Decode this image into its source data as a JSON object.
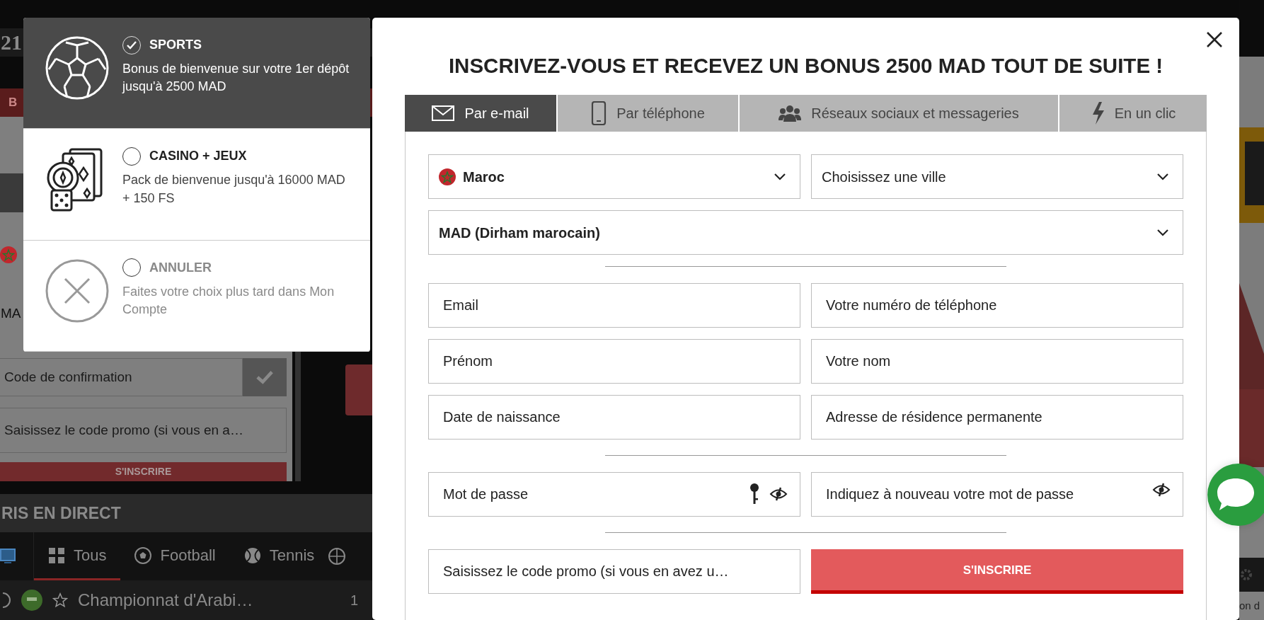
{
  "background": {
    "logo": "21",
    "tab": "B",
    "currency": "MA",
    "confirmation_field": {
      "placeholder": "Code de confirmation"
    },
    "promo_field": {
      "placeholder": "Saisissez le code promo (si vous en a…"
    },
    "submit": "S'INSCRIRE",
    "live_title": "RIS EN DIRECT",
    "sport_tabs": [
      {
        "label": "Tous",
        "selected": true
      },
      {
        "label": "Football",
        "selected": false
      },
      {
        "label": "Tennis",
        "selected": false
      }
    ],
    "event_row": {
      "name": "Championnat d'Arabi…",
      "count": "1"
    },
    "footer_text": "on d"
  },
  "bonus_options": [
    {
      "kind": "sports",
      "title": "SPORTS",
      "description": "Bonus de bienvenue sur votre 1er dépôt jusqu'à 2500 MAD",
      "selected": true
    },
    {
      "kind": "casino",
      "title": "CASINO + JEUX",
      "description": "Pack de bienvenue jusqu'à 16000 MAD + 150 FS",
      "selected": false
    },
    {
      "kind": "cancel",
      "title": "ANNULER",
      "description": "Faites votre choix plus tard dans Mon Compte",
      "selected": false
    }
  ],
  "modal": {
    "title": "INSCRIVEZ-VOUS ET RECEVEZ UN BONUS 2500 MAD TOUT DE SUITE !",
    "tabs": [
      {
        "kind": "email",
        "label": "Par e-mail",
        "selected": true
      },
      {
        "kind": "phone",
        "label": "Par téléphone",
        "selected": false
      },
      {
        "kind": "social",
        "label": "Réseaux sociaux et messageries",
        "selected": false
      },
      {
        "kind": "oneclick",
        "label": "En un clic",
        "selected": false
      }
    ],
    "country": {
      "value": "Maroc"
    },
    "city": {
      "placeholder": "Choisissez une ville"
    },
    "currency": {
      "value": "MAD (Dirham marocain)"
    },
    "fields": [
      {
        "placeholder": "Email"
      },
      {
        "placeholder": "Votre numéro de téléphone"
      },
      {
        "placeholder": "Prénom"
      },
      {
        "placeholder": "Votre nom"
      },
      {
        "placeholder": "Date de naissance"
      },
      {
        "placeholder": "Adresse de résidence permanente"
      }
    ],
    "password": {
      "placeholder": "Mot de passe"
    },
    "password_repeat": {
      "placeholder": "Indiquez à nouveau votre mot de passe"
    },
    "promo": {
      "placeholder": "Saisissez le code promo (si vous en avez u…"
    },
    "submit": "S'INSCRIRE"
  }
}
